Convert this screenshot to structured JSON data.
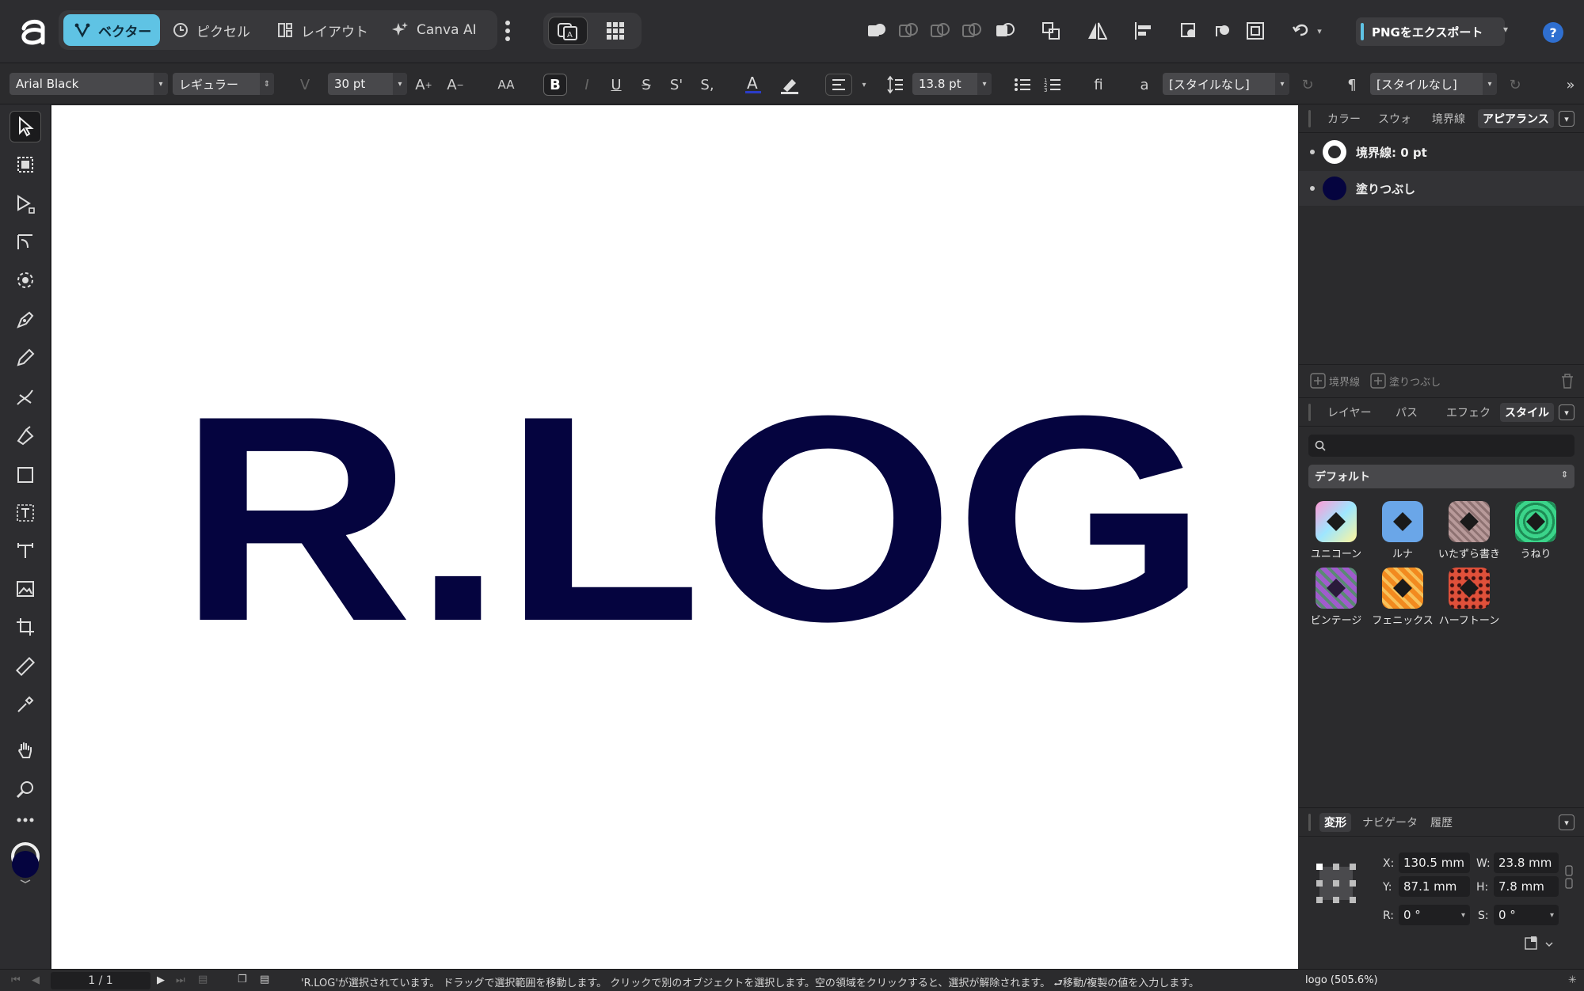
{
  "app": {
    "personas": [
      {
        "label": "ベクター",
        "active": true
      },
      {
        "label": "ピクセル",
        "active": false
      },
      {
        "label": "レイアウト",
        "active": false
      },
      {
        "label": "Canva AI",
        "active": false
      }
    ],
    "export_button": "PNGをエクスポート",
    "help": "?",
    "accent_color": "#5fc3e4"
  },
  "context_toolbar": {
    "font_family": "Arial Black",
    "font_style": "レギュラー",
    "font_size": "30 pt",
    "case_label": "AA",
    "bold": "B",
    "italic": "I",
    "underline": "U",
    "strike": "S",
    "superscript": "S'",
    "subscript": "S,",
    "leading": "13.8 pt",
    "ligature": "fi",
    "char_style_glyph": "a",
    "char_style": "[スタイルなし]",
    "para_glyph": "¶",
    "para_style": "[スタイルなし]"
  },
  "canvas": {
    "artwork_text": "R.LOG",
    "artwork_color": "#05043f"
  },
  "appearance_panel": {
    "tabs": [
      "カラー",
      "スウォ",
      "境界線",
      "アピアランス"
    ],
    "active_tab": "アピアランス",
    "rows": [
      {
        "label": "境界線: 0 pt",
        "kind": "stroke"
      },
      {
        "label": "塗りつぶし",
        "kind": "fill",
        "color": "#05043f"
      }
    ],
    "footer": {
      "add_stroke": "境界線",
      "add_fill": "塗りつぶし"
    }
  },
  "styles_panel": {
    "tabs": [
      "レイヤー",
      "パス",
      "エフェク",
      "スタイル"
    ],
    "active_tab": "スタイル",
    "category": "デフォルト",
    "items": [
      {
        "label": "ユニコーン",
        "color": "#f4a7d8"
      },
      {
        "label": "ルナ",
        "color": "#6aa6e8"
      },
      {
        "label": "いたずら書き",
        "color": "#b89a9a"
      },
      {
        "label": "うねり",
        "color": "#3bd48a"
      },
      {
        "label": "ビンテージ",
        "color": "#a05ccd"
      },
      {
        "label": "フェニックス",
        "color": "#f28a1f"
      },
      {
        "label": "ハーフトーン",
        "color": "#e0503a"
      }
    ]
  },
  "transform_panel": {
    "tabs": [
      "変形",
      "ナビゲータ",
      "履歴"
    ],
    "active_tab": "変形",
    "x_label": "X:",
    "x": "130.5 mm",
    "y_label": "Y:",
    "y": "87.1 mm",
    "w_label": "W:",
    "w": "23.8 mm",
    "h_label": "H:",
    "h": "7.8 mm",
    "r_label": "R:",
    "r": "0 °",
    "s_label": "S:",
    "s": "0 °"
  },
  "status_bar": {
    "page": "1 / 1",
    "message": "'R.LOG'が選択されています。 ドラッグで選択範囲を移動します。 クリックで別のオブジェクトを選択します。空の領域をクリックすると、選択が解除されます。 ⮐移動/複製の値を入力します。",
    "document": "logo (505.6%)"
  }
}
